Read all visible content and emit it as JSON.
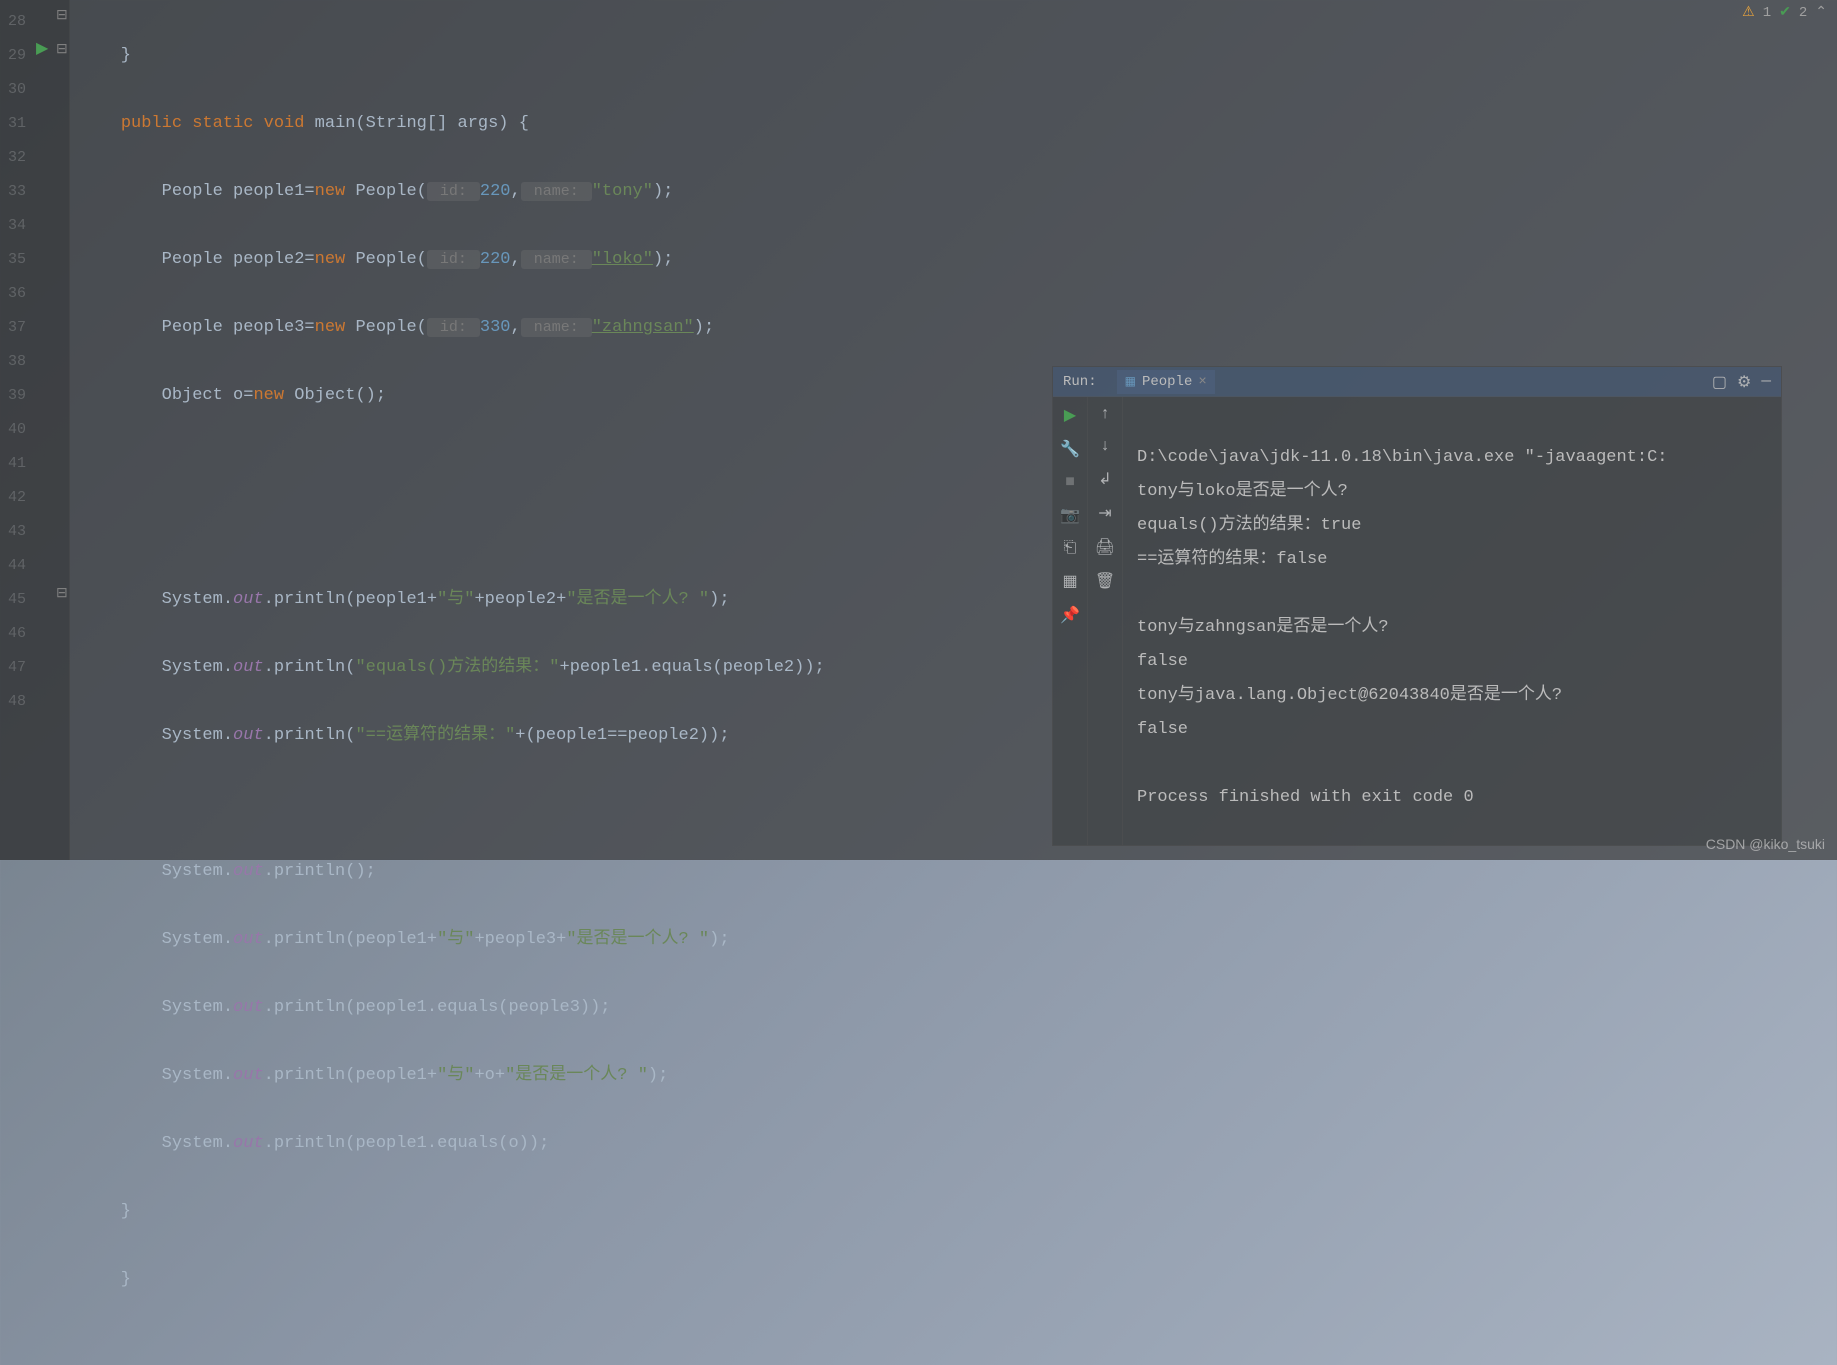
{
  "gutter": {
    "lines": [
      "28",
      "29",
      "30",
      "31",
      "32",
      "33",
      "34",
      "35",
      "36",
      "37",
      "38",
      "39",
      "40",
      "41",
      "42",
      "43",
      "44",
      "45",
      "46",
      "47",
      "48"
    ]
  },
  "status": {
    "warn_count": "1",
    "check_count": "2"
  },
  "code": {
    "l28": "    }",
    "l29a": "    ",
    "l29_public": "public",
    "l29_static": "static",
    "l29_void": "void",
    "l29_main": " main(String[] args) {",
    "l30a": "        People people1=",
    "l30_new": "new",
    "l30b": " People(",
    "l30_hint1": " id: ",
    "l30_num": "220",
    "l30_comma": ",",
    "l30_hint2": " name: ",
    "l30_str": "\"tony\"",
    "l30c": ");",
    "l31a": "        People people2=",
    "l31_new": "new",
    "l31b": " People(",
    "l31_hint1": " id: ",
    "l31_num": "220",
    "l31_comma": ",",
    "l31_hint2": " name: ",
    "l31_str": "\"loko\"",
    "l31c": ");",
    "l32a": "        People people3=",
    "l32_new": "new",
    "l32b": " People(",
    "l32_hint1": " id: ",
    "l32_num": "330",
    "l32_comma": ",",
    "l32_hint2": " name: ",
    "l32_str": "\"zahngsan\"",
    "l32c": ");",
    "l33a": "        Object o=",
    "l33_new": "new",
    "l33b": " Object();",
    "l36a": "        System.",
    "l36_out": "out",
    "l36b": ".println(people1+",
    "l36_s1": "\"与\"",
    "l36c": "+people2+",
    "l36_s2": "\"是否是一个人? \"",
    "l36d": ");",
    "l37a": "        System.",
    "l37_out": "out",
    "l37b": ".println(",
    "l37_s1": "\"equals()方法的结果：\"",
    "l37c": "+people1.equals(people2));",
    "l38a": "        System.",
    "l38_out": "out",
    "l38b": ".println(",
    "l38_s1": "\"==运算符的结果：\"",
    "l38c": "+(people1==people2));",
    "l40a": "        System.",
    "l40_out": "out",
    "l40b": ".println();",
    "l41a": "        System.",
    "l41_out": "out",
    "l41b": ".println(people1+",
    "l41_s1": "\"与\"",
    "l41c": "+people3+",
    "l41_s2": "\"是否是一个人? \"",
    "l41d": ");",
    "l42a": "        System.",
    "l42_out": "out",
    "l42b": ".println(people1.equals(people3));",
    "l43a": "        System.",
    "l43_out": "out",
    "l43b": ".println(people1+",
    "l43_s1": "\"与\"",
    "l43c": "+o+",
    "l43_s2": "\"是否是一个人? \"",
    "l43d": ");",
    "l44a": "        System.",
    "l44_out": "out",
    "l44b": ".println(people1.equals(o));",
    "l45": "    }",
    "l46": "    }"
  },
  "run": {
    "label": "Run:",
    "tab_name": "People",
    "output": {
      "l1": "D:\\code\\java\\jdk-11.0.18\\bin\\java.exe \"-javaagent:C:",
      "l2": "tony与loko是否是一个人?",
      "l3": "equals()方法的结果：true",
      "l4": "==运算符的结果：false",
      "l5": "",
      "l6": "tony与zahngsan是否是一个人?",
      "l7": "false",
      "l8": "tony与java.lang.Object@62043840是否是一个人?",
      "l9": "false",
      "l10": "",
      "l11": "Process finished with exit code 0"
    }
  },
  "watermark": "CSDN @kiko_tsuki"
}
